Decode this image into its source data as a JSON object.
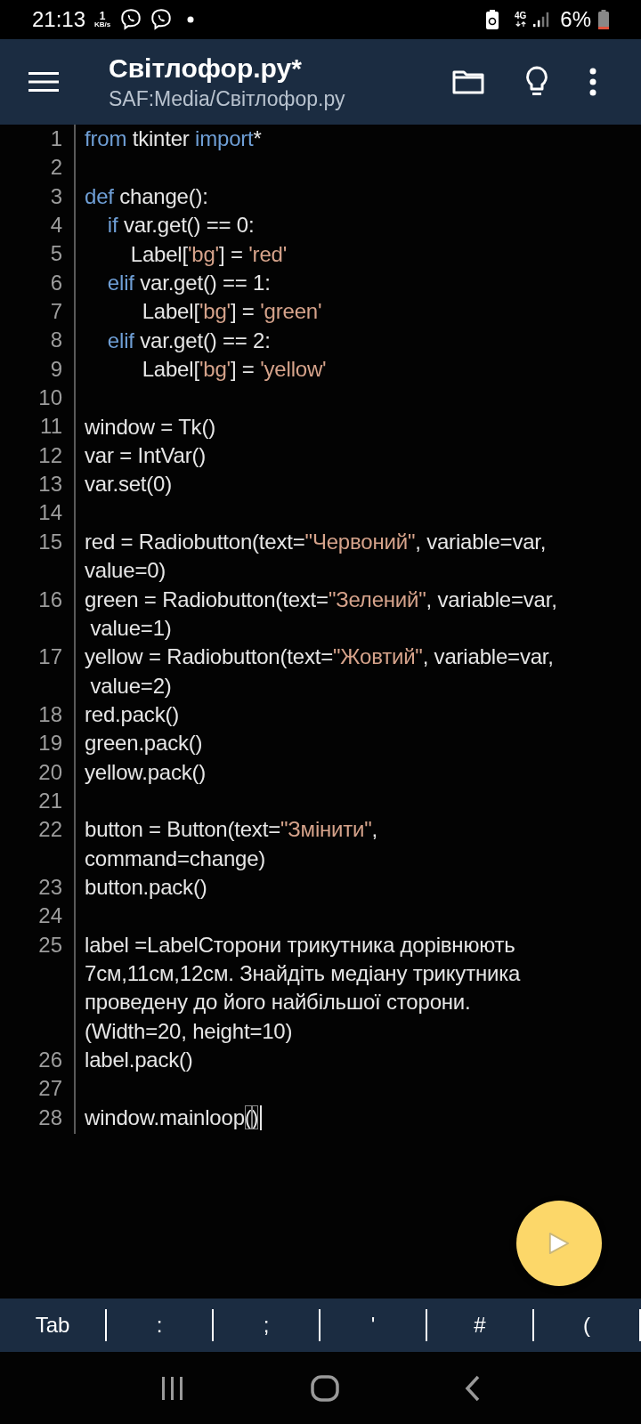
{
  "status_bar": {
    "time": "21:13",
    "speed_value": "1",
    "speed_unit": "KB/s",
    "network": "4G",
    "battery": "6%"
  },
  "app_bar": {
    "title": "Світлофор.ру*",
    "subtitle": "SAF:Media/Світлофор.ру"
  },
  "editor": {
    "lines": [
      {
        "number": "1",
        "cursor": false,
        "rows": [
          [
            {
              "kind": "keyword",
              "text": "from"
            },
            {
              "kind": "plain",
              "text": " tkinter "
            },
            {
              "kind": "keyword",
              "text": "import"
            },
            {
              "kind": "plain",
              "text": "*"
            }
          ]
        ]
      },
      {
        "number": "2",
        "cursor": false
      },
      {
        "number": "3",
        "cursor": false,
        "rows": [
          [
            {
              "kind": "keyword",
              "text": "def"
            },
            {
              "kind": "plain",
              "text": " change():"
            }
          ]
        ]
      },
      {
        "number": "4",
        "cursor": false,
        "rows": [
          [
            {
              "kind": "keyword",
              "text": "    if"
            },
            {
              "kind": "plain",
              "text": " var.get() == 0:"
            }
          ]
        ]
      },
      {
        "number": "5",
        "cursor": false,
        "rows": [
          [
            {
              "kind": "plain",
              "text": "        Label["
            },
            {
              "kind": "string",
              "text": "'bg'"
            },
            {
              "kind": "plain",
              "text": "] = "
            },
            {
              "kind": "string",
              "text": "'red'"
            }
          ]
        ]
      },
      {
        "number": "6",
        "cursor": false,
        "rows": [
          [
            {
              "kind": "keyword",
              "text": "    elif"
            },
            {
              "kind": "plain",
              "text": " var.get() == 1:"
            }
          ]
        ]
      },
      {
        "number": "7",
        "cursor": false,
        "rows": [
          [
            {
              "kind": "plain",
              "text": "          Label["
            },
            {
              "kind": "string",
              "text": "'bg'"
            },
            {
              "kind": "plain",
              "text": "] = "
            },
            {
              "kind": "string",
              "text": "'green'"
            }
          ]
        ]
      },
      {
        "number": "8",
        "cursor": false,
        "rows": [
          [
            {
              "kind": "keyword",
              "text": "    elif"
            },
            {
              "kind": "plain",
              "text": " var.get() == 2:"
            }
          ]
        ]
      },
      {
        "number": "9",
        "cursor": false,
        "rows": [
          [
            {
              "kind": "plain",
              "text": "          Label["
            },
            {
              "kind": "string",
              "text": "'bg'"
            },
            {
              "kind": "plain",
              "text": "] = "
            },
            {
              "kind": "string",
              "text": "'yellow'"
            }
          ]
        ]
      },
      {
        "number": "10",
        "cursor": false
      },
      {
        "number": "11",
        "cursor": false,
        "rows": [
          [
            {
              "kind": "plain",
              "text": "window = Tk()"
            }
          ]
        ]
      },
      {
        "number": "12",
        "cursor": false,
        "rows": [
          [
            {
              "kind": "plain",
              "text": "var = IntVar()"
            }
          ]
        ]
      },
      {
        "number": "13",
        "cursor": false,
        "rows": [
          [
            {
              "kind": "plain",
              "text": "var.set(0)"
            }
          ]
        ]
      },
      {
        "number": "14",
        "cursor": false
      },
      {
        "number": "15",
        "cursor": false,
        "rows": [
          [
            {
              "kind": "plain",
              "text": "red = Radiobutton(text="
            },
            {
              "kind": "string",
              "text": "\"Червоний\""
            },
            {
              "kind": "plain",
              "text": ", variable=var,"
            }
          ],
          [
            {
              "kind": "plain",
              "text": "value=0)"
            }
          ]
        ]
      },
      {
        "number": "16",
        "cursor": false,
        "rows": [
          [
            {
              "kind": "plain",
              "text": "green = Radiobutton(text="
            },
            {
              "kind": "string",
              "text": "\"Зелений\""
            },
            {
              "kind": "plain",
              "text": ", variable=var,"
            }
          ],
          [
            {
              "kind": "plain",
              "text": " value=1)"
            }
          ]
        ]
      },
      {
        "number": "17",
        "cursor": false,
        "rows": [
          [
            {
              "kind": "plain",
              "text": "yellow = Radiobutton(text="
            },
            {
              "kind": "string",
              "text": "\"Жовтий\""
            },
            {
              "kind": "plain",
              "text": ", variable=var,"
            }
          ],
          [
            {
              "kind": "plain",
              "text": " value=2)"
            }
          ]
        ]
      },
      {
        "number": "18",
        "cursor": false,
        "rows": [
          [
            {
              "kind": "plain",
              "text": "red.pack()"
            }
          ]
        ]
      },
      {
        "number": "19",
        "cursor": false,
        "rows": [
          [
            {
              "kind": "plain",
              "text": "green.pack()"
            }
          ]
        ]
      },
      {
        "number": "20",
        "cursor": false,
        "rows": [
          [
            {
              "kind": "plain",
              "text": "yellow.pack()"
            }
          ]
        ]
      },
      {
        "number": "21",
        "cursor": false
      },
      {
        "number": "22",
        "cursor": false,
        "rows": [
          [
            {
              "kind": "plain",
              "text": "button = Button(text="
            },
            {
              "kind": "string",
              "text": "\"Змінити\""
            },
            {
              "kind": "plain",
              "text": ","
            }
          ],
          [
            {
              "kind": "plain",
              "text": "command=change)"
            }
          ]
        ]
      },
      {
        "number": "23",
        "cursor": false,
        "rows": [
          [
            {
              "kind": "plain",
              "text": "button.pack()"
            }
          ]
        ]
      },
      {
        "number": "24",
        "cursor": false
      },
      {
        "number": "25",
        "cursor": false,
        "rows": [
          [
            {
              "kind": "plain",
              "text": "label =LabelСторони трикутника дорівнюють"
            }
          ],
          [
            {
              "kind": "plain",
              "text": "7см,11см,12см. Знайдіть медіану трикутника"
            }
          ],
          [
            {
              "kind": "plain",
              "text": "проведену до його найбільшої сторони."
            }
          ],
          [
            {
              "kind": "plain",
              "text": "(Width=20, height=10)"
            }
          ]
        ]
      },
      {
        "number": "26",
        "cursor": false,
        "rows": [
          [
            {
              "kind": "plain",
              "text": "label.pack()"
            }
          ]
        ]
      },
      {
        "number": "27",
        "cursor": false
      },
      {
        "number": "28",
        "cursor": true,
        "rows": [
          [
            {
              "kind": "plain",
              "text": "window.mainloop"
            },
            {
              "kind": "bracket",
              "text": "("
            },
            {
              "kind": "bracket",
              "text": ")"
            }
          ]
        ]
      }
    ]
  },
  "symbol_keys": [
    "Tab",
    ":",
    ";",
    "'",
    "#",
    "("
  ]
}
